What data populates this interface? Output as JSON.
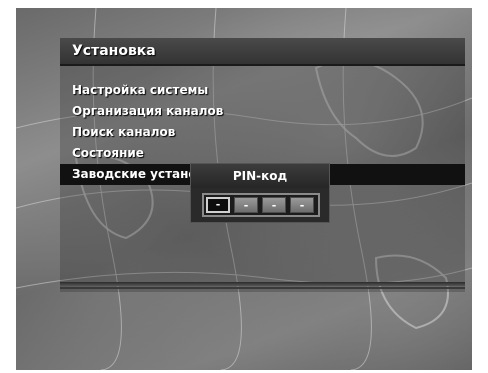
{
  "panel": {
    "title": "Установка"
  },
  "menu": {
    "items": [
      {
        "label": "Настройка системы"
      },
      {
        "label": "Организация каналов"
      },
      {
        "label": "Поиск каналов"
      },
      {
        "label": "Состояние"
      },
      {
        "label": "Заводские установки",
        "selected": true
      }
    ]
  },
  "pin_dialog": {
    "title": "PIN-код",
    "slots": [
      "-",
      "-",
      "-",
      "-"
    ],
    "active_slot": 1
  },
  "colors": {
    "title_bar": "#333333",
    "selected_row": "#111111",
    "text": "#ffffff"
  }
}
